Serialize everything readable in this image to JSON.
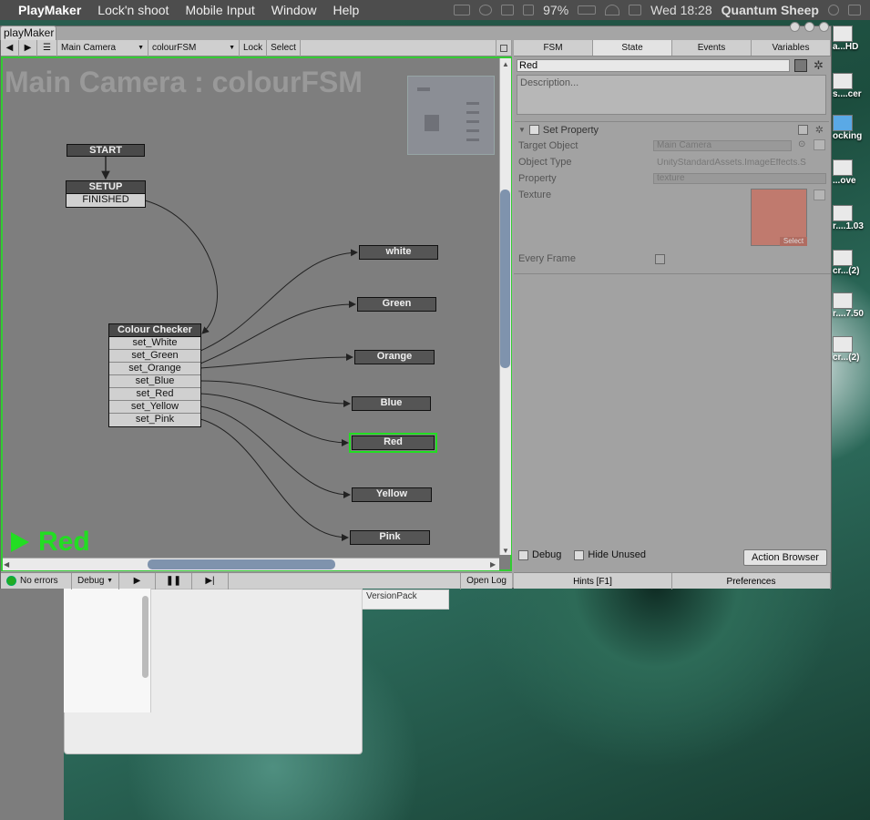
{
  "menubar": {
    "items": [
      "PlayMaker",
      "Lock'n shoot",
      "Mobile Input",
      "Window",
      "Help"
    ],
    "battery": "97%",
    "clock": "Wed 18:28",
    "user": "Quantum Sheep"
  },
  "desktop_icons": [
    {
      "label": "a...HD"
    },
    {
      "label": "s....cer"
    },
    {
      "label": "ocking"
    },
    {
      "label": "...ove"
    },
    {
      "label": "r....1.03"
    },
    {
      "label": "cr...(2)"
    },
    {
      "label": "r....7.50"
    },
    {
      "label": "cr...(2)"
    }
  ],
  "behind_tab": "VersionPack",
  "window": {
    "tab_title": "playMaker"
  },
  "toolbar": {
    "object": "Main Camera",
    "fsm": "colourFSM",
    "lock": "Lock",
    "select": "Select"
  },
  "canvas": {
    "title": "Main Camera : colourFSM",
    "start": "START",
    "setup": {
      "name": "SETUP",
      "event": "FINISHED"
    },
    "checker": {
      "name": "Colour Checker",
      "events": [
        "set_White",
        "set_Green",
        "set_Orange",
        "set_Blue",
        "set_Red",
        "set_Yellow",
        "set_Pink"
      ]
    },
    "states": [
      "white",
      "Green",
      "Orange",
      "Blue",
      "Red",
      "Yellow",
      "Pink"
    ],
    "active_state": "Red"
  },
  "status": {
    "errors": "No errors",
    "debug": "Debug",
    "open_log": "Open Log"
  },
  "inspector": {
    "tabs": [
      "FSM",
      "State",
      "Events",
      "Variables"
    ],
    "active_tab": "State",
    "state_name": "Red",
    "description_placeholder": "Description...",
    "action": "Set Property",
    "props": {
      "target_object_label": "Target Object",
      "target_object_value": "Main Camera",
      "object_type_label": "Object Type",
      "object_type_value": "UnityStandardAssets.ImageEffects.S",
      "property_label": "Property",
      "property_value": "texture",
      "texture_label": "Texture",
      "texture_select": "Select",
      "every_frame_label": "Every Frame"
    },
    "debug": "Debug",
    "hide_unused": "Hide Unused",
    "action_browser": "Action Browser",
    "hints": "Hints [F1]",
    "preferences": "Preferences",
    "texture_color": "#c07a6e"
  },
  "colors": {
    "active": "#22dd22",
    "canvas_bg": "#7e7e7e"
  }
}
